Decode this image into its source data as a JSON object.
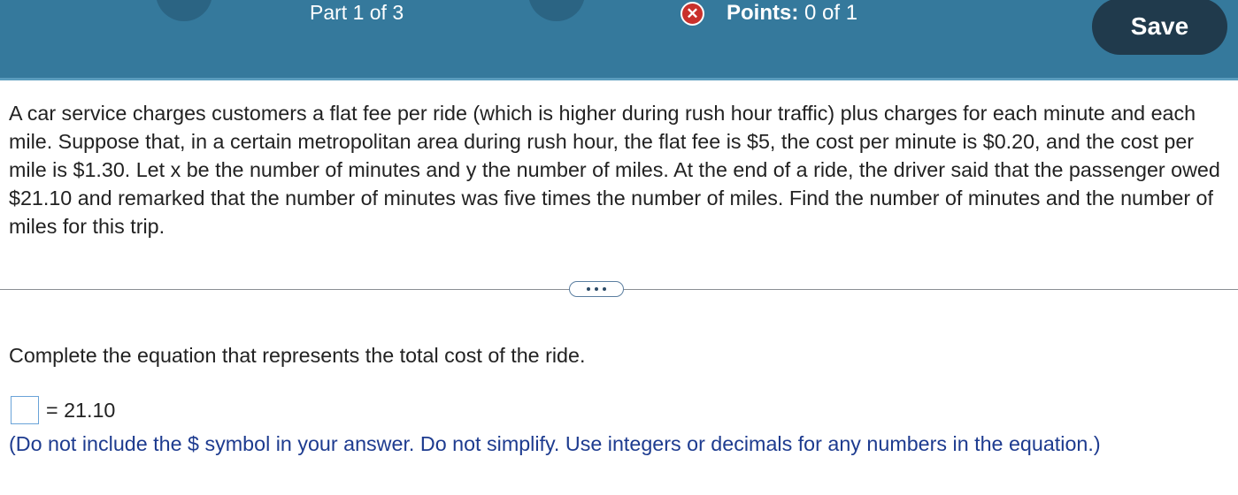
{
  "header": {
    "part_label": "Part 1 of 3",
    "points_label": "Points:",
    "points_value": "0 of 1",
    "status_icon": "x-circle-icon",
    "save_label": "Save",
    "colors": {
      "bar": "#35799c",
      "save_button": "#203a4c",
      "status_icon": "#c9302c"
    }
  },
  "question": {
    "text": "A car service charges customers a flat fee per ride (which is higher during rush hour traffic) plus charges for each minute and each mile. Suppose that, in a certain metropolitan area during rush hour, the flat fee is $5, the cost per minute is $0.20, and the cost per mile is $1.30. Let x be the number of minutes and y the number of miles. At the end of a ride, the driver said that the passenger owed $21.10 and remarked that the number of minutes was five times the number of miles. Find the number of minutes and the number of miles for this trip."
  },
  "part": {
    "instruction": "Complete the equation that represents the total cost of the ride.",
    "answer_value": "",
    "equation_rhs": "= 21.10",
    "note": "(Do not include the $ symbol in your answer. Do not simplify. Use integers or decimals for any numbers in the equation.)"
  }
}
